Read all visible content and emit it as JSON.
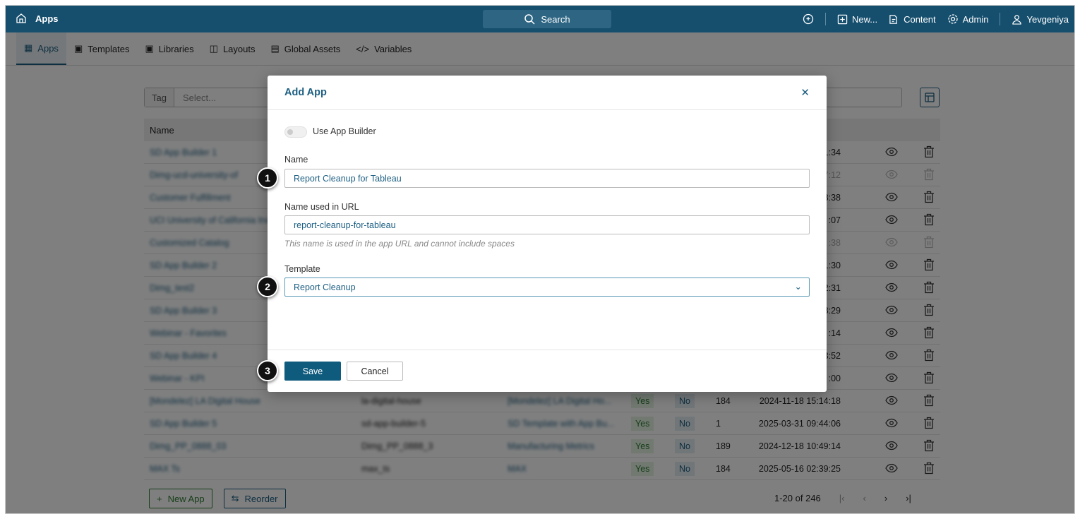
{
  "topbar": {
    "title": "Apps",
    "search": "Search",
    "new": "New...",
    "content": "Content",
    "admin": "Admin",
    "user": "Yevgeniya"
  },
  "tabs": [
    "Apps",
    "Templates",
    "Libraries",
    "Layouts",
    "Global Assets",
    "Variables"
  ],
  "filter": {
    "tag_label": "Tag",
    "tag_placeholder": "Select..."
  },
  "table": {
    "header_name": "Name",
    "rows": [
      {
        "name": "SD App Builder 1",
        "url": "",
        "template": "",
        "yes": "",
        "no": "",
        "count": "",
        "date": "1:34",
        "dim": false
      },
      {
        "name": "Dimg-ucd-university-of",
        "url": "",
        "template": "",
        "yes": "",
        "no": "",
        "count": "",
        "date": "7:12",
        "dim": true
      },
      {
        "name": "Customer Fulfillment",
        "url": "",
        "template": "",
        "yes": "",
        "no": "",
        "count": "",
        "date": "8:38",
        "dim": false
      },
      {
        "name": "UCI University of California Irvine",
        "url": "",
        "template": "",
        "yes": "",
        "no": "",
        "count": "",
        "date": ":07",
        "dim": false
      },
      {
        "name": "Customized Catalog",
        "url": "",
        "template": "",
        "yes": "",
        "no": "",
        "count": "",
        "date": ":38",
        "dim": true
      },
      {
        "name": "SD App Builder 2",
        "url": "",
        "template": "",
        "yes": "",
        "no": "",
        "count": "",
        "date": "1:30",
        "dim": false
      },
      {
        "name": "Dimg_test2",
        "url": "",
        "template": "",
        "yes": "",
        "no": "",
        "count": "",
        "date": "2:31",
        "dim": false
      },
      {
        "name": "SD App Builder 3",
        "url": "",
        "template": "",
        "yes": "",
        "no": "",
        "count": "",
        "date": "8:29",
        "dim": false
      },
      {
        "name": "Webinar - Favorites",
        "url": "",
        "template": "",
        "yes": "",
        "no": "",
        "count": "",
        "date": ":14",
        "dim": false
      },
      {
        "name": "SD App Builder 4",
        "url": "",
        "template": "",
        "yes": "",
        "no": "",
        "count": "",
        "date": "3:52",
        "dim": false
      },
      {
        "name": "Webinar - KPI",
        "url": "",
        "template": "",
        "yes": "",
        "no": "",
        "count": "",
        "date": ":00",
        "dim": false
      },
      {
        "name": "[Mondelez] LA Digital House",
        "url": "la-digital-house",
        "template": "[Mondelez] LA Digital Ho...",
        "yes": "Yes",
        "no": "No",
        "count": "184",
        "date": "2024-11-18 15:14:18",
        "dim": false
      },
      {
        "name": "SD App Builder 5",
        "url": "sd-app-builder-5",
        "template": "SD Template with App Bu...",
        "yes": "Yes",
        "no": "No",
        "count": "1",
        "date": "2025-03-31 09:44:06",
        "dim": false
      },
      {
        "name": "Dimg_PP_0888_03",
        "url": "Dimg_PP_0888_3",
        "template": "Manufacturing Metrics",
        "yes": "Yes",
        "no": "No",
        "count": "189",
        "date": "2024-12-18 10:49:14",
        "dim": false
      },
      {
        "name": "MAX Ts",
        "url": "max_ts",
        "template": "MAX",
        "yes": "Yes",
        "no": "No",
        "count": "184",
        "date": "2025-05-16 02:39:25",
        "dim": false
      }
    ]
  },
  "footer": {
    "new_app": "New App",
    "reorder": "Reorder",
    "pagination": "1-20 of 246"
  },
  "modal": {
    "title": "Add App",
    "toggle_label": "Use App Builder",
    "name_label": "Name",
    "name_value": "Report Cleanup for Tableau",
    "url_label": "Name used in URL",
    "url_value": "report-cleanup-for-tableau",
    "url_hint": "This name is used in the app URL and cannot include spaces",
    "template_label": "Template",
    "template_value": "Report Cleanup",
    "save": "Save",
    "cancel": "Cancel"
  },
  "badges": [
    "1",
    "2",
    "3"
  ]
}
